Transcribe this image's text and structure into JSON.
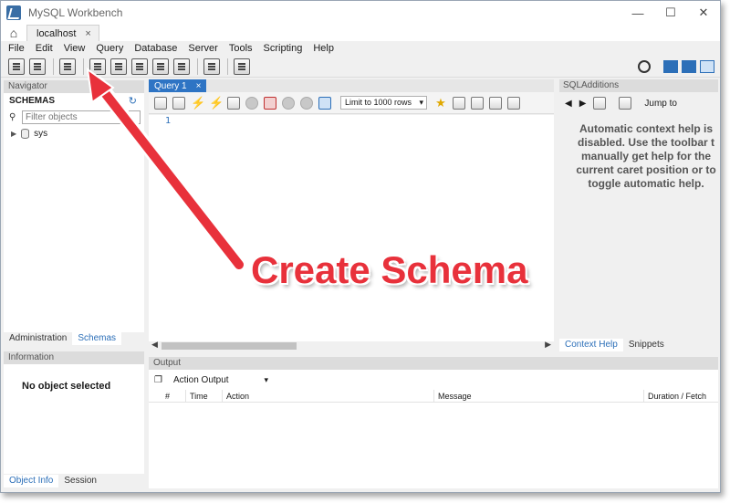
{
  "window": {
    "title": "MySQL Workbench",
    "controls": [
      "—",
      "☐",
      "✕"
    ]
  },
  "tabs": {
    "home_icon": "home-icon",
    "connection": "localhost",
    "close": "×"
  },
  "menu": [
    "File",
    "Edit",
    "View",
    "Query",
    "Database",
    "Server",
    "Tools",
    "Scripting",
    "Help"
  ],
  "navigator": {
    "header": "Navigator",
    "schemas_label": "SCHEMAS",
    "filter_placeholder": "Filter objects",
    "schemas": [
      {
        "name": "sys"
      }
    ],
    "tabs": [
      "Administration",
      "Schemas"
    ]
  },
  "information": {
    "header": "Information",
    "empty": "No object selected",
    "tabs": [
      "Object Info",
      "Session"
    ]
  },
  "query": {
    "tab": "Query 1",
    "tab_close": "×",
    "limit": "Limit to 1000 rows",
    "line_number": "1"
  },
  "sql_additions": {
    "header": "SQLAdditions",
    "jump_to": "Jump to",
    "help_lines": [
      "Automatic context help is",
      "disabled. Use the toolbar t",
      "manually get help for the",
      "current caret position or to",
      "toggle automatic help."
    ],
    "tabs": [
      "Context Help",
      "Snippets"
    ]
  },
  "output": {
    "header": "Output",
    "select": "Action Output",
    "columns": [
      "#",
      "Time",
      "Action",
      "Message",
      "Duration / Fetch"
    ]
  },
  "annotation": {
    "text": "Create Schema",
    "color": "#e8313b"
  }
}
